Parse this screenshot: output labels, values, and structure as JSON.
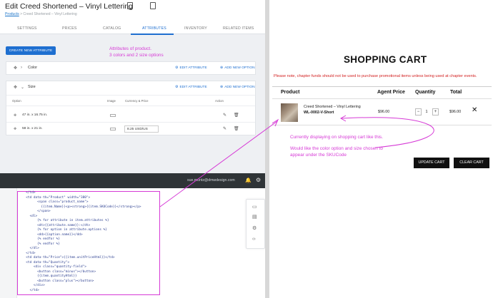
{
  "admin": {
    "title": "Edit Creed Shortened – Vinyl Lettering",
    "breadcrumb": {
      "link": "Products",
      "rest": " > Creed Shortened – Vinyl Lettering"
    },
    "tabs": [
      "SETTINGS",
      "PRICES",
      "CATALOG",
      "ATTRIBUTES",
      "INVENTORY",
      "RELATED ITEMS"
    ],
    "active_tab": "ATTRIBUTES",
    "create_button": "CREATE NEW ATTRIBUTE",
    "edit_attribute_label": "EDIT ATTRIBUTE",
    "add_option_label": "ADD NEW OPTION",
    "attributes": [
      {
        "name": "Color"
      },
      {
        "name": "Size"
      }
    ],
    "option_columns": [
      "Option",
      "Image",
      "Currency & Price",
      "Action"
    ],
    "size_options": [
      {
        "name": "47 in. x 16.75 in.",
        "price": ""
      },
      {
        "name": "58 in. x 21 in.",
        "price": "8.25 USD/US"
      }
    ]
  },
  "annotations": {
    "attributes_note": [
      "Attributes of product.",
      "3 colors and 2 size options"
    ],
    "cart_note": [
      "Currently displaying on shopping cart like this.",
      "",
      "Would like the color option and size chosen to",
      "appear under the SKUCode"
    ]
  },
  "editor": {
    "email": "sue.muntz@dmwdesign.com",
    "code_lines": [
      "  </td>",
      "  <td data-th=\"Product\" width=\"380\">",
      "        <span class=\"product_name\">",
      "          {{item.Name}}<p><strong>{{item.SKUCode}}</strong></p>",
      "        </span>",
      "    <dl>",
      "        {% for attribute in item.attributes %}",
      "        <dt>{{attribute.name}}:</dt>",
      "        {% for option in attribute.options %}",
      "        <dd>{{option.name}}</dd>",
      "        {% endfor %}",
      "        {% endfor %}",
      "    </dl>",
      "  </td>",
      "  <td data-th=\"Price\">{{item.unitPriceHtml}}</td>",
      "  <td data-th=\"Quantity\">",
      "",
      "      <div class=\"quantity-field\">",
      "        <button class=\"minus\"></button>",
      "        {{item.quantityHtml}}",
      "        <button class=\"plus\"></button>",
      "",
      "      </div>",
      "",
      "    </td>"
    ]
  },
  "cart": {
    "title": "SHOPPING CART",
    "warning": "Please note, chapter funds should not be used to purchase promotional items unless being used at chapter events.",
    "columns": {
      "product": "Product",
      "agent_price": "Agent Price",
      "quantity": "Quantity",
      "total": "Total"
    },
    "item": {
      "name": "Creed Shortened – Vinyl Lettering",
      "sku": "WL-0002-V-Short",
      "agent_price": "$96.00",
      "quantity": "1",
      "total": "$96.00"
    },
    "update_button": "UPDATE CART",
    "clear_button": "CLEAR CART"
  },
  "colors": {
    "accent": "#1e6fd0",
    "annotation": "#d63ad6",
    "warning": "#d21f1f",
    "editor_bar": "#2f3437"
  }
}
